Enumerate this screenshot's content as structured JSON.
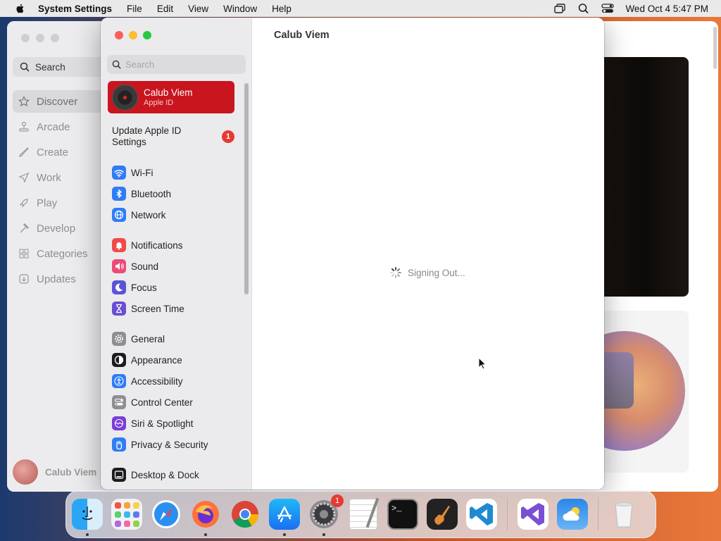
{
  "menubar": {
    "app_name": "System Settings",
    "items": [
      "File",
      "Edit",
      "View",
      "Window",
      "Help"
    ],
    "clock": "Wed Oct 4  5:47 PM"
  },
  "background_app": {
    "search_label": "Search",
    "nav": [
      "Discover",
      "Arcade",
      "Create",
      "Work",
      "Play",
      "Develop",
      "Categories",
      "Updates"
    ],
    "selected": "Discover",
    "user_name": "Calub Viem"
  },
  "settings": {
    "search_placeholder": "Search",
    "account": {
      "name": "Calub Viem",
      "subtitle": "Apple ID"
    },
    "update": {
      "label": "Update Apple ID Settings",
      "badge": "1"
    },
    "groups": [
      [
        {
          "label": "Wi-Fi",
          "icon": "wifi-icon",
          "color": "#2f7cf6"
        },
        {
          "label": "Bluetooth",
          "icon": "bluetooth-icon",
          "color": "#2f7cf6"
        },
        {
          "label": "Network",
          "icon": "globe-icon",
          "color": "#2f7cf6"
        }
      ],
      [
        {
          "label": "Notifications",
          "icon": "bell-icon",
          "color": "#ef4b4b"
        },
        {
          "label": "Sound",
          "icon": "speaker-icon",
          "color": "#ee4a79"
        },
        {
          "label": "Focus",
          "icon": "moon-icon",
          "color": "#5b54d6"
        },
        {
          "label": "Screen Time",
          "icon": "hourglass-icon",
          "color": "#6a4fd3"
        }
      ],
      [
        {
          "label": "General",
          "icon": "gear-icon",
          "color": "#8e8e93"
        },
        {
          "label": "Appearance",
          "icon": "appearance-icon",
          "color": "#1c1c1e"
        },
        {
          "label": "Accessibility",
          "icon": "accessibility-icon",
          "color": "#2f7cf6"
        },
        {
          "label": "Control Center",
          "icon": "control-center-icon",
          "color": "#8e8e93"
        },
        {
          "label": "Siri & Spotlight",
          "icon": "siri-icon",
          "color": "#7a3dd8"
        },
        {
          "label": "Privacy & Security",
          "icon": "hand-icon",
          "color": "#2f7cf6"
        }
      ],
      [
        {
          "label": "Desktop & Dock",
          "icon": "dock-icon",
          "color": "#1c1c1e"
        }
      ]
    ],
    "content_title": "Calub Viem",
    "status_text": "Signing Out..."
  },
  "dock": {
    "apps": [
      {
        "name": "finder-icon",
        "running": true
      },
      {
        "name": "launchpad-icon",
        "running": false
      },
      {
        "name": "safari-icon",
        "running": false
      },
      {
        "name": "firefox-icon",
        "running": true
      },
      {
        "name": "chrome-icon",
        "running": false
      },
      {
        "name": "app-store-icon",
        "running": true
      },
      {
        "name": "system-settings-icon",
        "running": true,
        "badge": "1"
      },
      {
        "name": "textedit-icon",
        "running": false
      },
      {
        "name": "terminal-icon",
        "running": false
      },
      {
        "name": "garageband-icon",
        "running": false
      },
      {
        "name": "vscode-icon",
        "running": false
      },
      {
        "name": "visual-studio-icon",
        "running": false
      },
      {
        "name": "weather-icon",
        "running": false
      },
      {
        "name": "trash-icon",
        "running": false
      }
    ]
  }
}
